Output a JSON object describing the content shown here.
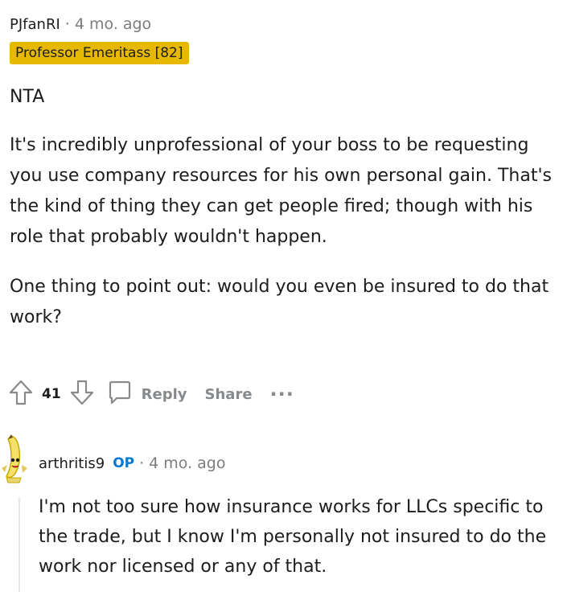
{
  "comment1": {
    "username": "PJfanRI",
    "separator": "·",
    "time": "4 mo. ago",
    "flair": "Professor Emeritass [82]",
    "paragraphs": [
      "NTA",
      "It's incredibly unprofessional of your boss to be requesting you use company resources for his own personal gain. That's the kind of thing they can get people fired; though with his role that probably wouldn't happen.",
      "One thing to point out: would you even be insured to do that work?"
    ],
    "votes": "41",
    "reply_label": "Reply",
    "share_label": "Share",
    "more_label": "···"
  },
  "comment2": {
    "username": "arthritis9",
    "op_badge": "OP",
    "separator": "·",
    "time": "4 mo. ago",
    "text": "I'm not too sure how insurance works for LLCs specific to the trade, but I know I'm personally not insured to do the work nor licensed or any of that."
  },
  "icons": {
    "upvote": "arrow-up-icon",
    "downvote": "arrow-down-icon",
    "reply": "speech-bubble-icon",
    "more": "ellipsis-icon",
    "avatar": "banana-avatar-icon"
  },
  "colors": {
    "flair_bg": "#e6b800",
    "op_blue": "#0079d3",
    "muted": "#878a8c"
  }
}
